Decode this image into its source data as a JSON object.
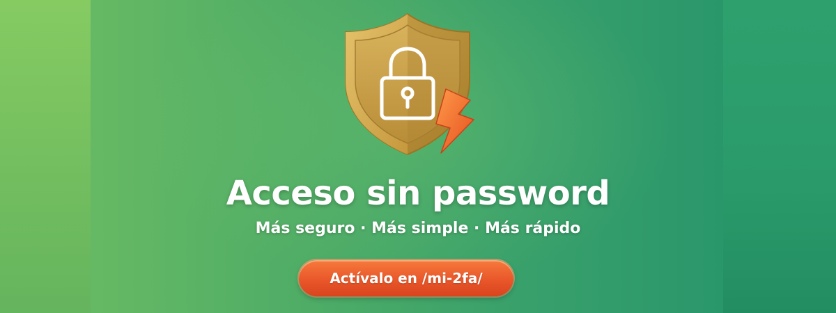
{
  "hero": {
    "headline": "Acceso sin password",
    "subheadline": "Más seguro · Más simple · Más rápido",
    "cta_label": "Actívalo en /mi-2fa/"
  },
  "icons": {
    "shield": "shield-icon",
    "lock": "padlock-icon",
    "bolt": "lightning-bolt-icon"
  },
  "colors": {
    "background_left": "#7ac560",
    "background_right": "#279468",
    "shield_gold": "#c9a24a",
    "bolt_orange": "#f26a2a",
    "cta_orange": "#e9572a",
    "text": "#ffffff"
  }
}
